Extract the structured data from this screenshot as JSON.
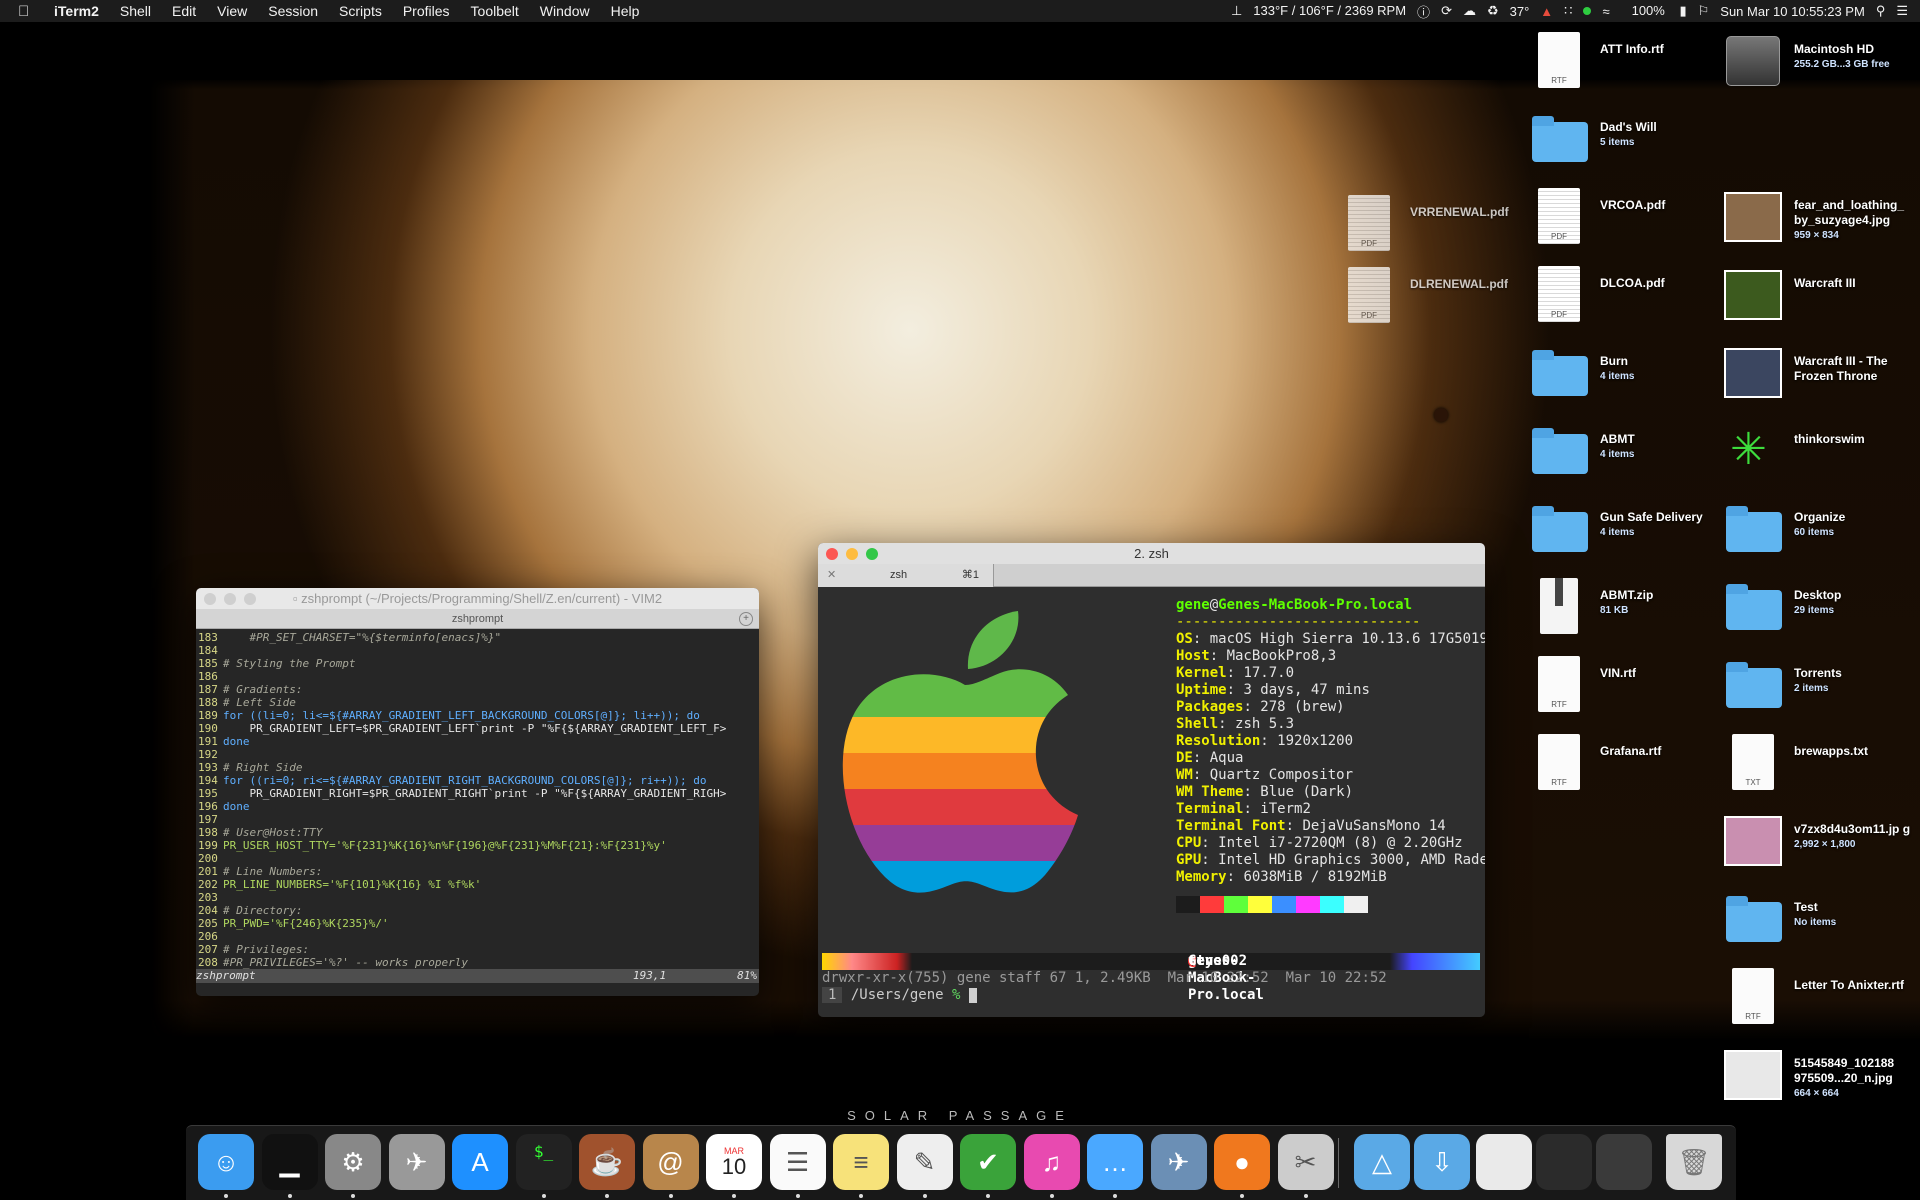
{
  "menubar": {
    "apple_icon": "apple-logo-icon",
    "app_name": "iTerm2",
    "menus": [
      "Shell",
      "Edit",
      "View",
      "Session",
      "Scripts",
      "Profiles",
      "Toolbelt",
      "Window",
      "Help"
    ],
    "status": {
      "fan": "133°F / 106°F / 2369 RPM",
      "weather": "37°",
      "battery": "100%",
      "clock": "Sun Mar 10  10:55:23 PM"
    }
  },
  "wallpaper_title": "SOLAR PASSAGE",
  "desktop": {
    "icons": [
      {
        "id": "att",
        "name": "ATT Info.rtf",
        "sub": "",
        "kind": "doc",
        "ext": "RTF"
      },
      {
        "id": "dadswill",
        "name": "Dad's Will",
        "sub": "5 items",
        "kind": "folder"
      },
      {
        "id": "vrcoa",
        "name": "VRCOA.pdf",
        "sub": "",
        "kind": "pdf",
        "ext": "PDF"
      },
      {
        "id": "dlcoa",
        "name": "DLCOA.pdf",
        "sub": "",
        "kind": "pdf",
        "ext": "PDF"
      },
      {
        "id": "burn",
        "name": "Burn",
        "sub": "4 items",
        "kind": "folder"
      },
      {
        "id": "abmt",
        "name": "ABMT",
        "sub": "4 items",
        "kind": "folder"
      },
      {
        "id": "gunsafe",
        "name": "Gun Safe Delivery",
        "sub": "4 items",
        "kind": "folder"
      },
      {
        "id": "abmtzip",
        "name": "ABMT.zip",
        "sub": "81 KB",
        "kind": "zip",
        "ext": "ZIP"
      },
      {
        "id": "vin",
        "name": "VIN.rtf",
        "sub": "",
        "kind": "doc",
        "ext": "RTF"
      },
      {
        "id": "grafana",
        "name": "Grafana.rtf",
        "sub": "",
        "kind": "doc",
        "ext": "RTF"
      },
      {
        "id": "machd",
        "name": "Macintosh HD",
        "sub": "255.2 GB...3 GB free",
        "kind": "disk"
      },
      {
        "id": "fear",
        "name": "fear_and_loathing_ by_suzyage4.jpg",
        "sub": "959 × 834",
        "kind": "thumb",
        "color": "#8a6a4a"
      },
      {
        "id": "wc3",
        "name": "Warcraft III",
        "sub": "",
        "kind": "thumb",
        "color": "#3c5a1e"
      },
      {
        "id": "wc3tft",
        "name": "Warcraft III - The Frozen Throne",
        "sub": "",
        "kind": "thumb",
        "color": "#3b4660"
      },
      {
        "id": "tos",
        "name": "thinkorswim",
        "sub": "",
        "kind": "tos"
      },
      {
        "id": "organize",
        "name": "Organize",
        "sub": "60 items",
        "kind": "folder"
      },
      {
        "id": "desktop",
        "name": "Desktop",
        "sub": "29 items",
        "kind": "folder"
      },
      {
        "id": "torrents",
        "name": "Torrents",
        "sub": "2 items",
        "kind": "folder"
      },
      {
        "id": "brewapps",
        "name": "brewapps.txt",
        "sub": "",
        "kind": "doc",
        "ext": "TXT"
      },
      {
        "id": "v7zx",
        "name": "v7zx8d4u3om11.jp g",
        "sub": "2,992 × 1,800",
        "kind": "thumb",
        "color": "#c98fb0"
      },
      {
        "id": "test",
        "name": "Test",
        "sub": "No items",
        "kind": "folder"
      },
      {
        "id": "letter",
        "name": "Letter To Anixter.rtf",
        "sub": "",
        "kind": "doc",
        "ext": "RTF"
      },
      {
        "id": "img5154",
        "name": "51545849_102188 975509...20_n.jpg",
        "sub": "664 × 664",
        "kind": "thumb",
        "color": "#e8e8e8"
      },
      {
        "id": "vrrenewal",
        "name": "VRRENEWAL.pdf",
        "sub": "",
        "kind": "pdf",
        "ext": "PDF"
      },
      {
        "id": "dlrenewal",
        "name": "DLRENEWAL.pdf",
        "sub": "",
        "kind": "pdf",
        "ext": "PDF"
      }
    ]
  },
  "vim": {
    "title": "zshprompt (~/Projects/Programming/Shell/Z.en/current) - VIM2",
    "tab": "zshprompt",
    "lines": [
      {
        "n": "183",
        "t": "    #PR_SET_CHARSET=\"%{$terminfo[enacs]%}\"",
        "c": "c-com"
      },
      {
        "n": "184",
        "t": "",
        "c": ""
      },
      {
        "n": "185",
        "t": "# Styling the Prompt",
        "c": "c-com"
      },
      {
        "n": "186",
        "t": "",
        "c": ""
      },
      {
        "n": "187",
        "t": "# Gradients:",
        "c": "c-com"
      },
      {
        "n": "188",
        "t": "# Left Side",
        "c": "c-com"
      },
      {
        "n": "189",
        "t": "for ((li=0; li<=${#ARRAY_GRADIENT_LEFT_BACKGROUND_COLORS[@]}; li++)); do",
        "c": "c-kw"
      },
      {
        "n": "190",
        "t": "    PR_GRADIENT_LEFT=$PR_GRADIENT_LEFT`print -P \"%F{${ARRAY_GRADIENT_LEFT_F>",
        "c": ""
      },
      {
        "n": "191",
        "t": "done",
        "c": "c-kw"
      },
      {
        "n": "192",
        "t": "",
        "c": ""
      },
      {
        "n": "193",
        "t": "# Right Side",
        "c": "c-com"
      },
      {
        "n": "194",
        "t": "for ((ri=0; ri<=${#ARRAY_GRADIENT_RIGHT_BACKGROUND_COLORS[@]}; ri++)); do",
        "c": "c-kw"
      },
      {
        "n": "195",
        "t": "    PR_GRADIENT_RIGHT=$PR_GRADIENT_RIGHT`print -P \"%F{${ARRAY_GRADIENT_RIGH>",
        "c": ""
      },
      {
        "n": "196",
        "t": "done",
        "c": "c-kw"
      },
      {
        "n": "197",
        "t": "",
        "c": ""
      },
      {
        "n": "198",
        "t": "# User@Host:TTY",
        "c": "c-com"
      },
      {
        "n": "199",
        "t": "PR_USER_HOST_TTY='%F{231}%K{16}%n%F{196}@%F{231}%M%F{21}:%F{231}%y'",
        "c": "c-str"
      },
      {
        "n": "200",
        "t": "",
        "c": ""
      },
      {
        "n": "201",
        "t": "# Line Numbers:",
        "c": "c-com"
      },
      {
        "n": "202",
        "t": "PR_LINE_NUMBERS='%F{101}%K{16} %I %f%k'",
        "c": "c-str"
      },
      {
        "n": "203",
        "t": "",
        "c": ""
      },
      {
        "n": "204",
        "t": "# Directory:",
        "c": "c-com"
      },
      {
        "n": "205",
        "t": "PR_PWD='%F{246}%K{235}%/'",
        "c": "c-str"
      },
      {
        "n": "206",
        "t": "",
        "c": ""
      },
      {
        "n": "207",
        "t": "# Privileges:",
        "c": "c-com"
      },
      {
        "n": "208",
        "t": "#PR_PRIVILEGES='%?' -- works properly",
        "c": "c-com"
      }
    ],
    "status_file": "zshprompt",
    "status_pos": "193,1",
    "status_pct": "81%"
  },
  "terminal": {
    "title": "2. zsh",
    "tab_name": "zsh",
    "tab_shortcut": "⌘1",
    "user": "gene",
    "host": "Genes-MacBook-Pro.local",
    "separator": "-----------------------------",
    "info": [
      {
        "k": "OS",
        "v": "macOS High Sierra 10.13.6 17G5019"
      },
      {
        "k": "Host",
        "v": "MacBookPro8,3"
      },
      {
        "k": "Kernel",
        "v": "17.7.0"
      },
      {
        "k": "Uptime",
        "v": "3 days, 47 mins"
      },
      {
        "k": "Packages",
        "v": "278 (brew)"
      },
      {
        "k": "Shell",
        "v": "zsh 5.3"
      },
      {
        "k": "Resolution",
        "v": "1920x1200"
      },
      {
        "k": "DE",
        "v": "Aqua"
      },
      {
        "k": "WM",
        "v": "Quartz Compositor"
      },
      {
        "k": "WM Theme",
        "v": "Blue (Dark)"
      },
      {
        "k": "Terminal",
        "v": "iTerm2"
      },
      {
        "k": "Terminal Font",
        "v": "DejaVuSansMono 14"
      },
      {
        "k": "CPU",
        "v": "Intel i7-2720QM (8) @ 2.20GHz"
      },
      {
        "k": "GPU",
        "v": "Intel HD Graphics 3000, AMD Rade"
      },
      {
        "k": "Memory",
        "v": "6038MiB / 8192MiB"
      }
    ],
    "swatch_colors": [
      "#1c1c1c",
      "#ff3b3b",
      "#5fff3b",
      "#ffff3b",
      "#3b8fff",
      "#ff3bff",
      "#3bffff",
      "#f0f0f0"
    ],
    "prompt_user": "gene",
    "prompt_host": "Genes-MacBook-Pro.local",
    "prompt_tty": "ttys002",
    "prompt_meta": "drwxr-xr-x(755) gene staff 67 1, 2.49KB  Mar 10 22:52  Mar 10 22:52",
    "prompt_line_no": "1",
    "prompt_dir": "/Users/gene",
    "prompt_char": "%"
  },
  "dock": {
    "apps": [
      {
        "id": "finder",
        "icon": "finder-icon",
        "color": "#3b9cf0"
      },
      {
        "id": "activity-monitor",
        "icon": "activity-monitor-icon",
        "color": "#111"
      },
      {
        "id": "system-preferences",
        "icon": "gear-icon",
        "color": "#888"
      },
      {
        "id": "launchpad",
        "icon": "rocket-icon",
        "color": "#999"
      },
      {
        "id": "app-store",
        "icon": "app-store-icon",
        "color": "#1e90ff"
      },
      {
        "id": "terminal",
        "icon": "terminal-icon",
        "color": "#222"
      },
      {
        "id": "cake",
        "icon": "cake-icon",
        "color": "#a0522d"
      },
      {
        "id": "contacts",
        "icon": "contacts-icon",
        "color": "#b8864b"
      },
      {
        "id": "calendar",
        "icon": "calendar-icon",
        "color": "#fff"
      },
      {
        "id": "reminders",
        "icon": "reminders-icon",
        "color": "#fafafa"
      },
      {
        "id": "notes",
        "icon": "notes-icon",
        "color": "#f7e27a"
      },
      {
        "id": "textedit",
        "icon": "textedit-icon",
        "color": "#eee"
      },
      {
        "id": "vim",
        "icon": "vim-icon",
        "color": "#3aa33a"
      },
      {
        "id": "itunes",
        "icon": "music-icon",
        "color": "#e84ab0"
      },
      {
        "id": "messages",
        "icon": "messages-icon",
        "color": "#4aa8ff"
      },
      {
        "id": "mail-bird",
        "icon": "bird-icon",
        "color": "#6b8fb5"
      },
      {
        "id": "firefox",
        "icon": "firefox-icon",
        "color": "#f0781e"
      },
      {
        "id": "screenshot",
        "icon": "scissors-icon",
        "color": "#ccc"
      }
    ],
    "calendar_month": "MAR",
    "calendar_day": "10",
    "terminal_glyph": "$_"
  }
}
